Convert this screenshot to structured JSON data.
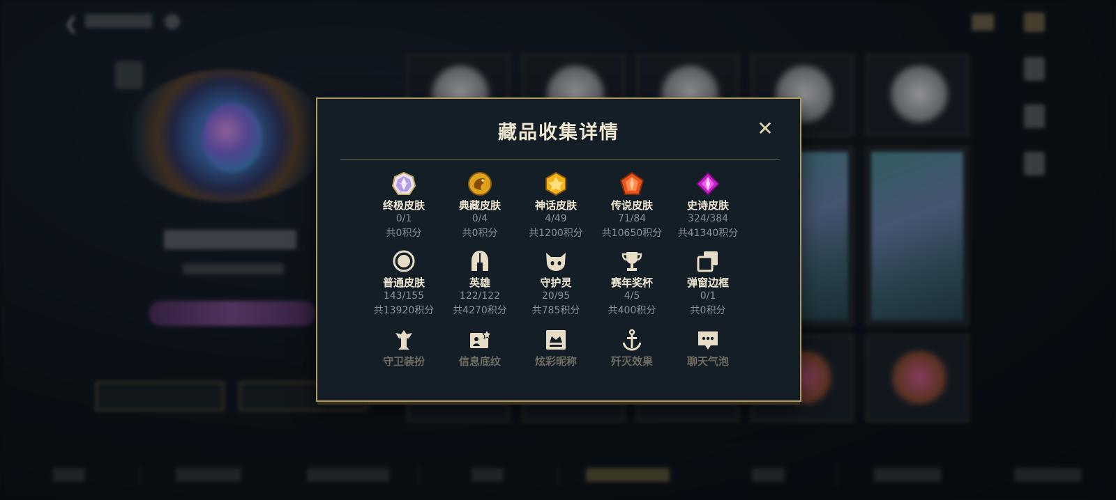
{
  "modal": {
    "title": "藏品收集详情",
    "close_glyph": "✕",
    "rows": [
      [
        {
          "label": "终极皮肤",
          "count": "0/1",
          "points": "共0积分",
          "icon": "ultimate-skin-gem-icon"
        },
        {
          "label": "典藏皮肤",
          "count": "0/4",
          "points": "共0积分",
          "icon": "collector-skin-dragon-icon"
        },
        {
          "label": "神话皮肤",
          "count": "4/49",
          "points": "共1200积分",
          "icon": "mythic-skin-gem-icon"
        },
        {
          "label": "传说皮肤",
          "count": "71/84",
          "points": "共10650积分",
          "icon": "legendary-skin-gem-icon"
        },
        {
          "label": "史诗皮肤",
          "count": "324/384",
          "points": "共41340积分",
          "icon": "epic-skin-gem-icon"
        }
      ],
      [
        {
          "label": "普通皮肤",
          "count": "143/155",
          "points": "共13920积分",
          "icon": "common-skin-ring-icon"
        },
        {
          "label": "英雄",
          "count": "122/122",
          "points": "共4270积分",
          "icon": "champion-helmet-icon"
        },
        {
          "label": "守护灵",
          "count": "20/95",
          "points": "共785积分",
          "icon": "guardian-spirit-icon"
        },
        {
          "label": "赛年奖杯",
          "count": "4/5",
          "points": "共400积分",
          "icon": "season-trophy-icon"
        },
        {
          "label": "弹窗边框",
          "count": "0/1",
          "points": "共0积分",
          "icon": "popup-frame-icon"
        }
      ],
      [
        {
          "label": "守卫装扮",
          "icon": "ward-skin-icon"
        },
        {
          "label": "信息底纹",
          "icon": "info-card-background-icon"
        },
        {
          "label": "炫彩昵称",
          "icon": "colorful-nickname-icon"
        },
        {
          "label": "歼灭效果",
          "icon": "kill-effect-icon"
        },
        {
          "label": "聊天气泡",
          "icon": "chat-bubble-icon"
        }
      ]
    ]
  },
  "colors": {
    "modal_border": "#b39a5e",
    "modal_bg": "#141e27",
    "title": "#efe6d0",
    "label": "#f1e8d2",
    "muted": "#8b9096"
  }
}
